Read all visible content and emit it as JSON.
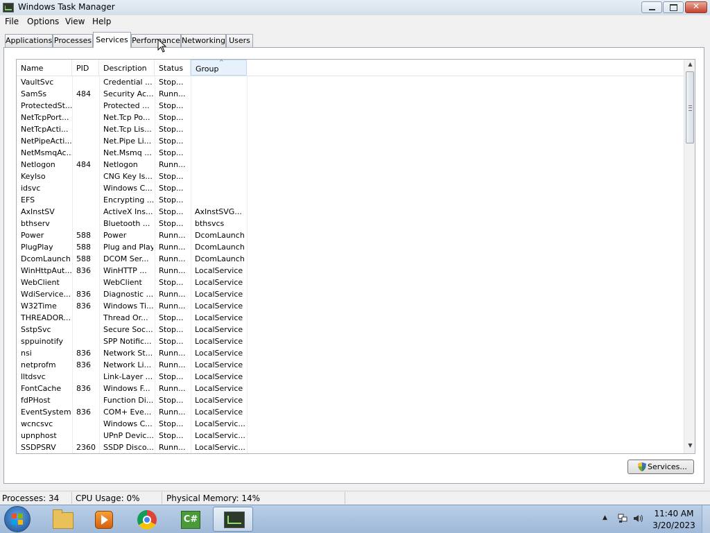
{
  "window": {
    "title": "Windows Task Manager"
  },
  "menu": [
    "File",
    "Options",
    "View",
    "Help"
  ],
  "tabs": [
    "Applications",
    "Processes",
    "Services",
    "Performance",
    "Networking",
    "Users"
  ],
  "active_tab": "Services",
  "columns": [
    "Name",
    "PID",
    "Description",
    "Status",
    "Group"
  ],
  "sorted_column": "Group",
  "services": [
    [
      "VaultSvc",
      "",
      "Credential ...",
      "Stop...",
      ""
    ],
    [
      "SamSs",
      "484",
      "Security Ac...",
      "Runn...",
      ""
    ],
    [
      "ProtectedSt...",
      "",
      "Protected ...",
      "Stop...",
      ""
    ],
    [
      "NetTcpPort...",
      "",
      "Net.Tcp Po...",
      "Stop...",
      ""
    ],
    [
      "NetTcpActi...",
      "",
      "Net.Tcp Lis...",
      "Stop...",
      ""
    ],
    [
      "NetPipeActi...",
      "",
      "Net.Pipe Li...",
      "Stop...",
      ""
    ],
    [
      "NetMsmqAc...",
      "",
      "Net.Msmq ...",
      "Stop...",
      ""
    ],
    [
      "Netlogon",
      "484",
      "Netlogon",
      "Runn...",
      ""
    ],
    [
      "KeyIso",
      "",
      "CNG Key Is...",
      "Stop...",
      ""
    ],
    [
      "idsvc",
      "",
      "Windows C...",
      "Stop...",
      ""
    ],
    [
      "EFS",
      "",
      "Encrypting ...",
      "Stop...",
      ""
    ],
    [
      "AxInstSV",
      "",
      "ActiveX Ins...",
      "Stop...",
      "AxInstSVG..."
    ],
    [
      "bthserv",
      "",
      "Bluetooth ...",
      "Stop...",
      "bthsvcs"
    ],
    [
      "Power",
      "588",
      "Power",
      "Runn...",
      "DcomLaunch"
    ],
    [
      "PlugPlay",
      "588",
      "Plug and Play",
      "Runn...",
      "DcomLaunch"
    ],
    [
      "DcomLaunch",
      "588",
      "DCOM Ser...",
      "Runn...",
      "DcomLaunch"
    ],
    [
      "WinHttpAut...",
      "836",
      "WinHTTP ...",
      "Runn...",
      "LocalService"
    ],
    [
      "WebClient",
      "",
      "WebClient",
      "Stop...",
      "LocalService"
    ],
    [
      "WdiService...",
      "836",
      "Diagnostic ...",
      "Runn...",
      "LocalService"
    ],
    [
      "W32Time",
      "836",
      "Windows Ti...",
      "Runn...",
      "LocalService"
    ],
    [
      "THREADOR...",
      "",
      "Thread Or...",
      "Stop...",
      "LocalService"
    ],
    [
      "SstpSvc",
      "",
      "Secure Soc...",
      "Stop...",
      "LocalService"
    ],
    [
      "sppuinotify",
      "",
      "SPP Notific...",
      "Stop...",
      "LocalService"
    ],
    [
      "nsi",
      "836",
      "Network St...",
      "Runn...",
      "LocalService"
    ],
    [
      "netprofm",
      "836",
      "Network Li...",
      "Runn...",
      "LocalService"
    ],
    [
      "lltdsvc",
      "",
      "Link-Layer ...",
      "Stop...",
      "LocalService"
    ],
    [
      "FontCache",
      "836",
      "Windows F...",
      "Runn...",
      "LocalService"
    ],
    [
      "fdPHost",
      "",
      "Function Di...",
      "Stop...",
      "LocalService"
    ],
    [
      "EventSystem",
      "836",
      "COM+ Eve...",
      "Runn...",
      "LocalService"
    ],
    [
      "wcncsvc",
      "",
      "Windows C...",
      "Stop...",
      "LocalServic..."
    ],
    [
      "upnphost",
      "",
      "UPnP Devic...",
      "Stop...",
      "LocalServic..."
    ],
    [
      "SSDPSRV",
      "2360",
      "SSDP Disco...",
      "Runn...",
      "LocalServic..."
    ]
  ],
  "services_button": "Services...",
  "status": {
    "processes": "Processes: 34",
    "cpu": "CPU Usage: 0%",
    "memory": "Physical Memory: 14%"
  },
  "taskbar": {
    "apps": [
      "folder-icon",
      "media-player-icon",
      "chrome-icon",
      "csharp-icon",
      "task-manager-icon"
    ],
    "time": "11:40 AM",
    "date": "3/20/2023"
  },
  "colors": {
    "taskbar": "#a9c2de",
    "sorted_header": "#e7f1fb"
  }
}
